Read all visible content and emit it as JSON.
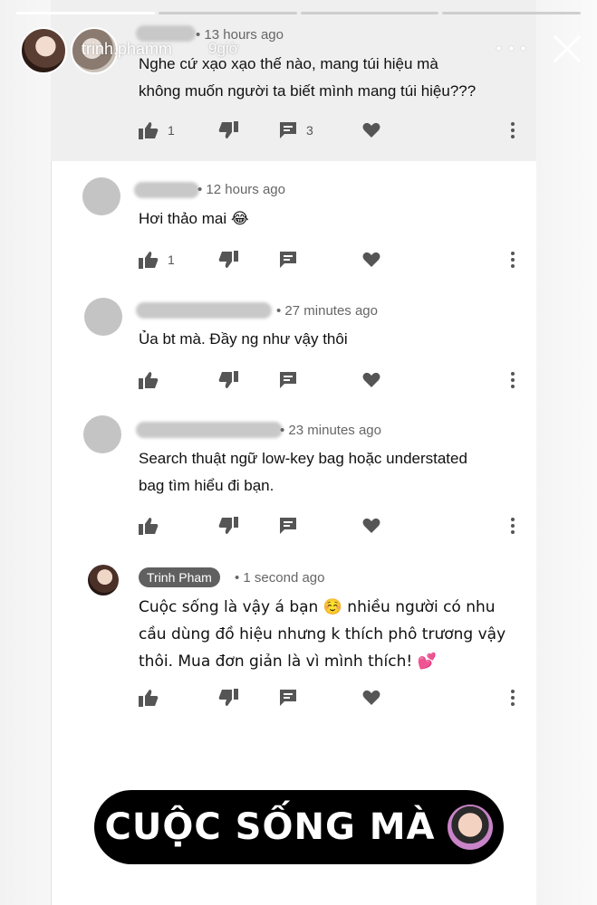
{
  "story": {
    "username": "trinh.phamm",
    "time": "9giờ"
  },
  "comments": [
    {
      "time": "• 13 hours ago",
      "text_lines": [
        "Nghe cứ xạo xạo thế nào, mang túi hiệu mà",
        "không muốn người ta biết mình mang túi hiệu???"
      ],
      "likes": "1",
      "replies": "3"
    },
    {
      "time": "• 12 hours ago",
      "text_lines": [
        "Hơi thảo mai 😂"
      ],
      "likes": "1",
      "replies": ""
    },
    {
      "time": "• 27 minutes ago",
      "text_lines": [
        "Ủa bt mà. Đầy ng như vậy thôi"
      ],
      "likes": "",
      "replies": ""
    },
    {
      "time": "• 23 minutes ago",
      "text_lines": [
        "Search thuật ngữ low-key bag hoặc understated",
        "bag tìm hiểu đi bạn."
      ],
      "likes": "",
      "replies": ""
    }
  ],
  "owner_reply": {
    "author": "Trinh Pham",
    "time": "• 1 second ago",
    "text_lines": [
      "Cuộc sống là vậy á bạn ☺️ nhiều người có nhu",
      "cầu dùng đồ hiệu nhưng k thích phô trương vậy",
      "thôi. Mua đơn giản là vì mình thích! 💕"
    ]
  },
  "sticker": {
    "text": "CUỘC SỐNG MÀ"
  },
  "icons": [
    "thumb-up-icon",
    "thumb-down-icon",
    "reply-icon",
    "heart-icon",
    "more-vertical-icon",
    "close-icon",
    "more-horizontal-icon"
  ],
  "colors": {
    "owner_badge": "#606060",
    "icon": "#555555"
  }
}
